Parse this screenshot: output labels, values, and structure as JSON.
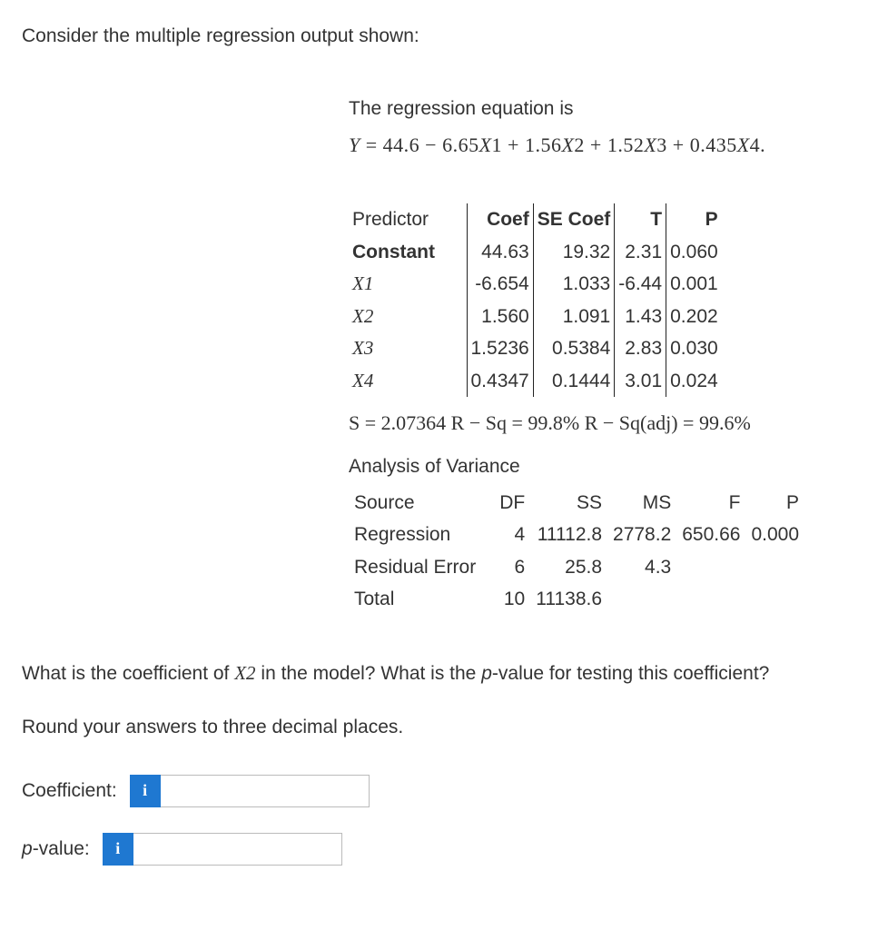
{
  "intro": "Consider the multiple regression output shown:",
  "equation_intro": "The regression equation is",
  "equation": "Y = 44.6 − 6.65X1 + 1.56X2 + 1.52X3 + 0.435X4.",
  "coef_table": {
    "headers": [
      "Predictor",
      "Coef",
      "SE Coef",
      "T",
      "P"
    ],
    "rows": [
      {
        "predictor": "Constant",
        "coef": "44.63",
        "se": "19.32",
        "t": "2.31",
        "p": "0.060"
      },
      {
        "predictor": "X1",
        "coef": "-6.654",
        "se": "1.033",
        "t": "-6.44",
        "p": "0.001"
      },
      {
        "predictor": "X2",
        "coef": "1.560",
        "se": "1.091",
        "t": "1.43",
        "p": "0.202"
      },
      {
        "predictor": "X3",
        "coef": "1.5236",
        "se": "0.5384",
        "t": "2.83",
        "p": "0.030"
      },
      {
        "predictor": "X4",
        "coef": "0.4347",
        "se": "0.1444",
        "t": "3.01",
        "p": "0.024"
      }
    ]
  },
  "stat_line": "S = 2.07364 R − Sq = 99.8% R − Sq(adj) = 99.6%",
  "anova_title": "Analysis of Variance",
  "anova": {
    "headers": [
      "Source",
      "DF",
      "SS",
      "MS",
      "F",
      "P"
    ],
    "rows": [
      {
        "source": "Regression",
        "df": "4",
        "ss": "11112.8",
        "ms": "2778.2",
        "f": "650.66",
        "p": "0.000"
      },
      {
        "source": "Residual Error",
        "df": "6",
        "ss": "25.8",
        "ms": "4.3",
        "f": "",
        "p": ""
      },
      {
        "source": "Total",
        "df": "10",
        "ss": "11138.6",
        "ms": "",
        "f": "",
        "p": ""
      }
    ]
  },
  "question_pre": "What is the coefficient of ",
  "question_var": "X2",
  "question_mid": " in the model? What is the ",
  "question_pval": "p",
  "question_post": "-value for testing this coefficient?",
  "instruction": "Round your answers to three decimal places.",
  "answers": {
    "coefficient_label": "Coefficient:",
    "pvalue_label_pre": "p",
    "pvalue_label_post": "-value:",
    "info_icon": "i"
  }
}
